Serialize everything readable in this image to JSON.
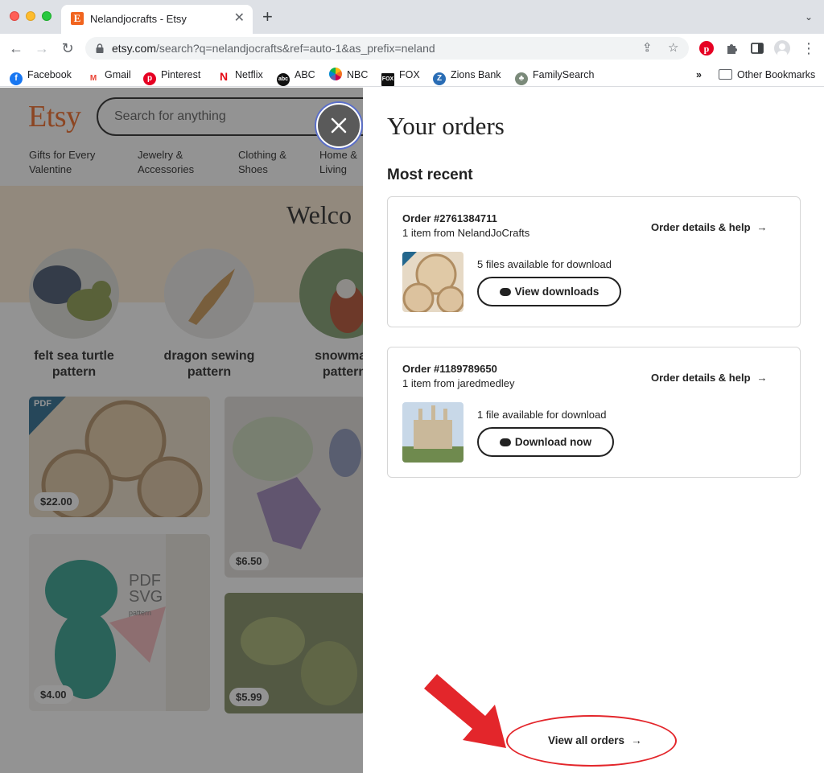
{
  "browser": {
    "tab_title": "Nelandjocrafts - Etsy",
    "tab_favicon": "E",
    "url_host": "etsy.com",
    "url_path": "/search?q=nelandjocrafts&ref=auto-1&as_prefix=neland",
    "bookmarks": [
      "Facebook",
      "Gmail",
      "Pinterest",
      "Netflix",
      "ABC",
      "NBC",
      "FOX",
      "Zions Bank",
      "FamilySearch"
    ],
    "more_bookmarks": "»",
    "other_bookmarks": "Other Bookmarks"
  },
  "etsy": {
    "logo": "Etsy",
    "search_placeholder": "Search for anything",
    "categories": [
      {
        "line1": "Gifts for Every",
        "line2": "Valentine"
      },
      {
        "line1": "Jewelry &",
        "line2": "Accessories"
      },
      {
        "line1": "Clothing &",
        "line2": "Shoes"
      },
      {
        "line1": "Home &",
        "line2": "Living"
      }
    ],
    "welcome": "Welco",
    "circle_labels": [
      {
        "line1": "felt sea turtle",
        "line2": "pattern"
      },
      {
        "line1": "dragon sewing",
        "line2": "pattern"
      },
      {
        "line1": "snowman",
        "line2": "pattern"
      }
    ],
    "tile_prices": [
      "$22.00",
      "$6.50",
      "$4.00",
      "$5.99"
    ],
    "pdf_badge": "PDF",
    "pdf_svg_text": [
      "PDF",
      "SVG",
      "pattern"
    ]
  },
  "orders": {
    "title": "Your orders",
    "section": "Most recent",
    "items": [
      {
        "order_no": "Order #2761384711",
        "meta": "1 item from NelandJoCrafts",
        "details_link": "Order details & help",
        "availability": "5 files available for download",
        "button": "View downloads"
      },
      {
        "order_no": "Order #1189789650",
        "meta": "1 item from jaredmedley",
        "details_link": "Order details & help",
        "availability": "1 file available for download",
        "button": "Download now"
      }
    ],
    "view_all": "View all orders",
    "arrow": "→"
  },
  "colors": {
    "etsy_orange": "#f1641e",
    "annotation_red": "#e3262b"
  }
}
